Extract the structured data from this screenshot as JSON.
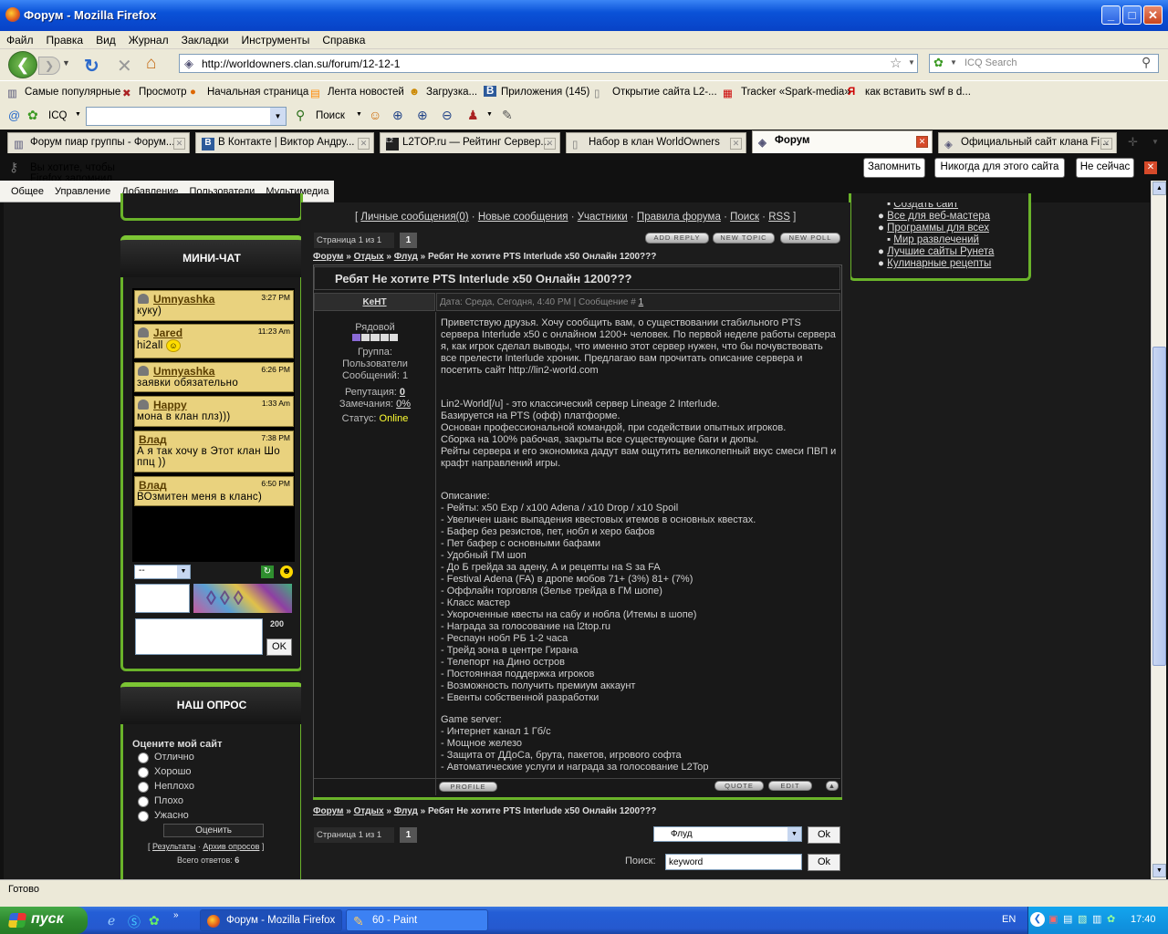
{
  "window": {
    "title": "Форум - Mozilla Firefox"
  },
  "menu": [
    "Файл",
    "Правка",
    "Вид",
    "Журнал",
    "Закладки",
    "Инструменты",
    "Справка"
  ],
  "nav": {
    "url": "http://worldowners.clan.su/forum/12-12-1",
    "search_placeholder": "ICQ Search"
  },
  "bookmarks": [
    "Самые популярные",
    "Просмотр",
    "Начальная страница",
    "Лента новостей",
    "Загрузка...",
    "Приложения (145)",
    "Открытие сайта L2-...",
    "Tracker «Spark-media»",
    "как вставить swf в d..."
  ],
  "icqbar": {
    "label": "ICQ",
    "search": "Поиск"
  },
  "tabs": [
    "Форум пиар группы - Форум...",
    "В Контакте | Виктор Андру...",
    "L2TOP.ru — Рейтинг Сервер...",
    "Набор в клан WorldOwners",
    "Форум",
    "Официальный сайт клана Fi..."
  ],
  "notification": {
    "text": "Вы хотите, чтобы Firefox запомнил пароль для \"andrushuksv@mail.ru\" на clan.su?",
    "remember": "Запомнить",
    "never": "Никогда для этого сайта",
    "not_now": "Не сейчас"
  },
  "ucoz": [
    "Общее",
    "Управление",
    "Добавление",
    "Пользователи",
    "Мультимедиа"
  ],
  "left": {
    "minichat_title": "МИНИ-ЧАТ",
    "messages": [
      {
        "name": "Umnyashka",
        "time": "3:27 PM",
        "text": "куку)"
      },
      {
        "name": "Jared",
        "time": "11:23 Am",
        "text": "hi2all"
      },
      {
        "name": "Umnyashka",
        "time": "6:26 PM",
        "text": "заявки обязательно"
      },
      {
        "name": "Happy",
        "time": "1:33 Am",
        "text": "мона в клан плз)))"
      },
      {
        "name": "Влад",
        "time": "7:38 PM",
        "text": "А я так хочу в Этот клан Шо ппц ))"
      },
      {
        "name": "Влад",
        "time": "6:50 PM",
        "text": "ВОзмитен меня в кланс)"
      }
    ],
    "select": "--",
    "counter": "200",
    "ok": "OK",
    "poll_title": "НАШ ОПРОС",
    "poll_question": "Оцените мой сайт",
    "poll_options": [
      "Отлично",
      "Хорошо",
      "Неплохо",
      "Плохо",
      "Ужасно"
    ],
    "vote": "Оценить",
    "results": "Результаты",
    "archive": "Архив опросов",
    "total_label": "Всего ответов:",
    "total": "6"
  },
  "right_links": [
    "Создать сайт",
    "Все для веб-мастера",
    "Программы для всех",
    "Мир развлечений",
    "Лучшие сайты Рунета",
    "Кулинарные рецепты"
  ],
  "forum": {
    "toplinks": [
      "Личные сообщения(0)",
      "Новые сообщения",
      "Участники",
      "Правила форума",
      "Поиск",
      "RSS"
    ],
    "pages": "Страница 1 из 1",
    "page_num": "1",
    "btn_reply": "ADD REPLY",
    "btn_topic": "NEW TOPIC",
    "btn_poll": "NEW POLL",
    "crumbs": [
      "Форум",
      "Отдых",
      "Флуд"
    ],
    "crumb_current": "Ребят Не хотите PTS Interlude x50 Онлайн 1200???",
    "topic_title": "Ребят Не хотите PTS Interlude x50 Онлайн 1200???",
    "author": "KeHT",
    "post_meta": "Дата: Среда, Сегодня, 4:40 PM | Сообщение #",
    "post_num": "1",
    "rank": "Рядовой",
    "group_label": "Группа:",
    "group": "Пользователи",
    "msgs": "Сообщений: 1",
    "rep_label": "Репутация:",
    "rep": "0",
    "warn_label": "Замечания:",
    "warn": "0%",
    "status_label": "Статус:",
    "status": "Online",
    "para1": "Приветствую друзья. Хочу сообщить вам, о существовании стабильного PTS сервера Interlude x50 с онлайном 1200+ человек. По первой неделе работы сервера я, как игрок сделал выводы, что именно этот сервер нужен, что бы почувствовать все прелести Interlude хроник. Предлагаю вам прочитать описание сервера и посетить сайт http://lin2-world.com",
    "para2": "Lin2-World[/u] - это классический сервер Lineage 2 Interlude.\nБазируется на PTS (офф) платформе.\nОснован профессиональной командой, при содействии опытных игроков.\nСборка на 100% рабочая, закрыты все существующие баги и дюпы.\nРейты сервера и его экономика дадут вам ощутить великолепный вкус смеси ПВП и крафт направлений игры.",
    "para3": "Описание:\n- Рейты: x50 Exp / x100 Adena / x10 Drop / x10 Spoil\n- Увеличен шанс выпадения квестовых итемов в основных квестах.\n- Бафер без резистов, пет, нобл и херо бафов\n- Пет бафер с основными бафами\n- Удобный ГМ шоп\n- До Б грейда за адену, А и рецепты на S за FA\n- Festival Adena (FA) в дропе мобов 71+ (3%) 81+ (7%)\n- Оффлайн торговля (Зелье трейда в ГМ шопе)\n- Класс мастер\n- Укороченные квесты на сабу и нобла (Итемы в шопе)\n- Награда за голосование на l2top.ru\n- Респаун нобл РБ 1-2 часа\n- Трейд зона в центре Гирана\n- Телепорт на Дино остров\n- Постоянная поддержка игроков\n- Возможность получить премиум аккаунт\n- Евенты собственной разработки",
    "para4": "Game server:\n- Интернет канал 1 Гб/с\n- Мощное железо\n- Защита от ДДоСа, брута, пакетов, игрового софта\n- Автоматические услуги и награда за голосование L2Top",
    "btn_profile": "PROFILE",
    "btn_quote": "QUOTE",
    "btn_edit": "EDIT",
    "jump": "Флуд",
    "ok": "Ok",
    "search_label": "Поиск:",
    "search_value": "keyword"
  },
  "statusbar": "Готово",
  "taskbar": {
    "start": "пуск",
    "items": [
      "Форум - Mozilla Firefox",
      "60 - Paint"
    ],
    "lang": "EN",
    "clock": "17:40"
  }
}
